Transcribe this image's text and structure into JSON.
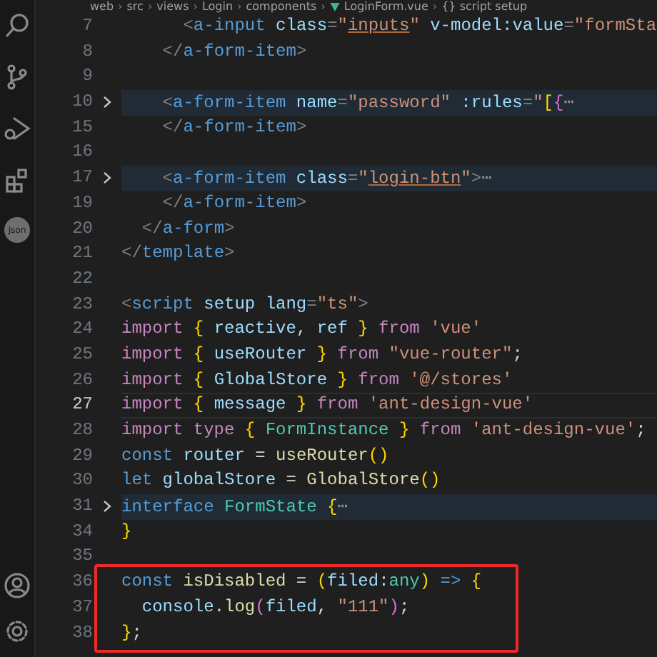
{
  "breadcrumb": [
    {
      "text": "web",
      "kind": "folder"
    },
    {
      "text": "›",
      "kind": "separator"
    },
    {
      "text": "src",
      "kind": "folder"
    },
    {
      "text": "›",
      "kind": "separator"
    },
    {
      "text": "views",
      "kind": "folder"
    },
    {
      "text": "›",
      "kind": "separator"
    },
    {
      "text": "Login",
      "kind": "folder"
    },
    {
      "text": "›",
      "kind": "separator"
    },
    {
      "text": "components",
      "kind": "folder"
    },
    {
      "text": "›",
      "kind": "separator"
    },
    {
      "text": "LoginForm.vue",
      "kind": "vue"
    },
    {
      "text": "›",
      "kind": "separator"
    },
    {
      "text": "{} script setup",
      "kind": "symbol"
    }
  ],
  "activity_bar": {
    "top": [
      {
        "kind": "search"
      },
      {
        "kind": "source"
      },
      {
        "kind": "debug"
      },
      {
        "kind": "extensions"
      },
      {
        "kind": "json",
        "label": "Json"
      }
    ],
    "bottom": [
      {
        "kind": "account"
      },
      {
        "kind": "gear"
      }
    ]
  },
  "lines": [
    {
      "number": "7",
      "fold": false,
      "highlighted": false,
      "current": false,
      "boxed": false,
      "tokens": [
        {
          "kind": "p",
          "text": "      <"
        },
        {
          "kind": "tag",
          "text": "a-input"
        },
        {
          "kind": "attr",
          "text": " class"
        },
        {
          "kind": "p",
          "text": "="
        },
        {
          "kind": "str",
          "text": "\""
        },
        {
          "kind": "ustr",
          "text": "inputs"
        },
        {
          "kind": "str",
          "text": "\""
        },
        {
          "kind": "attr",
          "text": " v-model:value"
        },
        {
          "kind": "p",
          "text": "="
        },
        {
          "kind": "str",
          "text": "\"formSta"
        }
      ]
    },
    {
      "number": "8",
      "fold": false,
      "highlighted": false,
      "current": false,
      "boxed": false,
      "tokens": [
        {
          "kind": "p",
          "text": "    </"
        },
        {
          "kind": "tag",
          "text": "a-form-item"
        },
        {
          "kind": "p",
          "text": ">"
        }
      ]
    },
    {
      "number": "9",
      "fold": false,
      "highlighted": false,
      "current": false,
      "boxed": false
    },
    {
      "number": "10",
      "fold": true,
      "highlighted": true,
      "current": false,
      "boxed": false,
      "tokens": [
        {
          "kind": "p",
          "text": "    <"
        },
        {
          "kind": "tag",
          "text": "a-form-item"
        },
        {
          "kind": "attr",
          "text": " name"
        },
        {
          "kind": "p",
          "text": "="
        },
        {
          "kind": "str",
          "text": "\"password\""
        },
        {
          "kind": "attr",
          "text": " :rules"
        },
        {
          "kind": "p",
          "text": "="
        },
        {
          "kind": "str",
          "text": "\""
        },
        {
          "kind": "b1",
          "text": "["
        },
        {
          "kind": "b2",
          "text": "{"
        },
        {
          "kind": "fold",
          "text": "⋯"
        }
      ]
    },
    {
      "number": "15",
      "fold": false,
      "highlighted": false,
      "current": false,
      "boxed": false,
      "tokens": [
        {
          "kind": "p",
          "text": "    </"
        },
        {
          "kind": "tag",
          "text": "a-form-item"
        },
        {
          "kind": "p",
          "text": ">"
        }
      ]
    },
    {
      "number": "16",
      "fold": false,
      "highlighted": false,
      "current": false,
      "boxed": false
    },
    {
      "number": "17",
      "fold": true,
      "highlighted": true,
      "current": false,
      "boxed": false,
      "tokens": [
        {
          "kind": "p",
          "text": "    <"
        },
        {
          "kind": "tag",
          "text": "a-form-item"
        },
        {
          "kind": "attr",
          "text": " class"
        },
        {
          "kind": "p",
          "text": "="
        },
        {
          "kind": "str",
          "text": "\""
        },
        {
          "kind": "ustr",
          "text": "login-btn"
        },
        {
          "kind": "str",
          "text": "\""
        },
        {
          "kind": "p",
          "text": ">"
        },
        {
          "kind": "fold",
          "text": "⋯"
        }
      ]
    },
    {
      "number": "19",
      "fold": false,
      "highlighted": false,
      "current": false,
      "boxed": false,
      "tokens": [
        {
          "kind": "p",
          "text": "    </"
        },
        {
          "kind": "tag",
          "text": "a-form-item"
        },
        {
          "kind": "p",
          "text": ">"
        }
      ]
    },
    {
      "number": "20",
      "fold": false,
      "highlighted": false,
      "current": false,
      "boxed": false,
      "tokens": [
        {
          "kind": "p",
          "text": "  </"
        },
        {
          "kind": "tag",
          "text": "a-form"
        },
        {
          "kind": "p",
          "text": ">"
        }
      ]
    },
    {
      "number": "21",
      "fold": false,
      "highlighted": false,
      "current": false,
      "boxed": false,
      "tokens": [
        {
          "kind": "p",
          "text": "</"
        },
        {
          "kind": "tag",
          "text": "template"
        },
        {
          "kind": "p",
          "text": ">"
        }
      ]
    },
    {
      "number": "22",
      "fold": false,
      "highlighted": false,
      "current": false,
      "boxed": false
    },
    {
      "number": "23",
      "fold": false,
      "highlighted": false,
      "current": false,
      "boxed": false,
      "tokens": [
        {
          "kind": "p",
          "text": "<"
        },
        {
          "kind": "tag",
          "text": "script"
        },
        {
          "kind": "attr",
          "text": " setup lang"
        },
        {
          "kind": "p",
          "text": "="
        },
        {
          "kind": "str",
          "text": "\"ts\""
        },
        {
          "kind": "p",
          "text": ">"
        }
      ]
    },
    {
      "number": "24",
      "fold": false,
      "highlighted": false,
      "current": false,
      "boxed": false,
      "tokens": [
        {
          "kind": "kw",
          "text": "import "
        },
        {
          "kind": "b1",
          "text": "{"
        },
        {
          "kind": "var",
          "text": " reactive"
        },
        {
          "kind": "text",
          "text": ", "
        },
        {
          "kind": "var",
          "text": "ref "
        },
        {
          "kind": "b1",
          "text": "}"
        },
        {
          "kind": "kw",
          "text": " from "
        },
        {
          "kind": "str",
          "text": "'vue'"
        }
      ]
    },
    {
      "number": "25",
      "fold": false,
      "highlighted": false,
      "current": false,
      "boxed": false,
      "tokens": [
        {
          "kind": "kw",
          "text": "import "
        },
        {
          "kind": "b1",
          "text": "{"
        },
        {
          "kind": "var",
          "text": " useRouter "
        },
        {
          "kind": "b1",
          "text": "}"
        },
        {
          "kind": "kw",
          "text": " from "
        },
        {
          "kind": "str",
          "text": "\"vue-router\""
        },
        {
          "kind": "text",
          "text": ";"
        }
      ]
    },
    {
      "number": "26",
      "fold": false,
      "highlighted": false,
      "current": false,
      "boxed": false,
      "tokens": [
        {
          "kind": "kw",
          "text": "import "
        },
        {
          "kind": "b1",
          "text": "{"
        },
        {
          "kind": "var",
          "text": " GlobalStore "
        },
        {
          "kind": "b1",
          "text": "}"
        },
        {
          "kind": "kw",
          "text": " from "
        },
        {
          "kind": "str",
          "text": "'@/stores'"
        }
      ]
    },
    {
      "number": "27",
      "fold": false,
      "highlighted": false,
      "current": true,
      "boxed": false,
      "tokens": [
        {
          "kind": "kw",
          "text": "import "
        },
        {
          "kind": "b1",
          "text": "{"
        },
        {
          "kind": "var",
          "text": " message "
        },
        {
          "kind": "b1",
          "text": "}"
        },
        {
          "kind": "kw",
          "text": " from "
        },
        {
          "kind": "str",
          "text": "'ant-design-vue'"
        }
      ]
    },
    {
      "number": "28",
      "fold": false,
      "highlighted": false,
      "current": false,
      "boxed": false,
      "tokens": [
        {
          "kind": "kw",
          "text": "import type "
        },
        {
          "kind": "b1",
          "text": "{"
        },
        {
          "kind": "type",
          "text": " FormInstance "
        },
        {
          "kind": "b1",
          "text": "}"
        },
        {
          "kind": "kw",
          "text": " from "
        },
        {
          "kind": "str",
          "text": "'ant-design-vue'"
        },
        {
          "kind": "text",
          "text": ";"
        }
      ]
    },
    {
      "number": "29",
      "fold": false,
      "highlighted": false,
      "current": false,
      "boxed": false,
      "tokens": [
        {
          "kind": "decl",
          "text": "const"
        },
        {
          "kind": "var",
          "text": " router"
        },
        {
          "kind": "text",
          "text": " = "
        },
        {
          "kind": "fn",
          "text": "useRouter"
        },
        {
          "kind": "b1",
          "text": "()"
        }
      ]
    },
    {
      "number": "30",
      "fold": false,
      "highlighted": false,
      "current": false,
      "boxed": false,
      "tokens": [
        {
          "kind": "decl",
          "text": "let"
        },
        {
          "kind": "var",
          "text": " globalStore"
        },
        {
          "kind": "text",
          "text": " = "
        },
        {
          "kind": "fn",
          "text": "GlobalStore"
        },
        {
          "kind": "b1",
          "text": "()"
        }
      ]
    },
    {
      "number": "31",
      "fold": true,
      "highlighted": true,
      "current": false,
      "boxed": false,
      "tokens": [
        {
          "kind": "decl",
          "text": "interface"
        },
        {
          "kind": "type",
          "text": " FormState "
        },
        {
          "kind": "b1",
          "text": "{"
        },
        {
          "kind": "fold",
          "text": "⋯"
        }
      ]
    },
    {
      "number": "34",
      "fold": false,
      "highlighted": false,
      "current": false,
      "boxed": false,
      "tokens": [
        {
          "kind": "b1",
          "text": "}"
        }
      ]
    },
    {
      "number": "35",
      "fold": false,
      "highlighted": false,
      "current": false,
      "boxed": false
    },
    {
      "number": "36",
      "fold": false,
      "highlighted": false,
      "current": false,
      "boxed": true,
      "tokens": [
        {
          "kind": "decl",
          "text": "const"
        },
        {
          "kind": "fn",
          "text": " isDisabled"
        },
        {
          "kind": "text",
          "text": " = "
        },
        {
          "kind": "b1",
          "text": "("
        },
        {
          "kind": "var",
          "text": "filed"
        },
        {
          "kind": "text",
          "text": ":"
        },
        {
          "kind": "type",
          "text": "any"
        },
        {
          "kind": "b1",
          "text": ")"
        },
        {
          "kind": "decl",
          "text": " => "
        },
        {
          "kind": "b1",
          "text": "{"
        }
      ]
    },
    {
      "number": "37",
      "fold": false,
      "highlighted": false,
      "current": false,
      "boxed": true,
      "tokens": [
        {
          "kind": "var",
          "text": "  console"
        },
        {
          "kind": "text",
          "text": "."
        },
        {
          "kind": "fn",
          "text": "log"
        },
        {
          "kind": "b2",
          "text": "("
        },
        {
          "kind": "var",
          "text": "filed"
        },
        {
          "kind": "text",
          "text": ", "
        },
        {
          "kind": "str",
          "text": "\"111\""
        },
        {
          "kind": "b2",
          "text": ")"
        },
        {
          "kind": "text",
          "text": ";"
        }
      ]
    },
    {
      "number": "38",
      "fold": false,
      "highlighted": false,
      "current": false,
      "boxed": true,
      "tokens": [
        {
          "kind": "b1",
          "text": "}"
        },
        {
          "kind": "text",
          "text": ";"
        }
      ]
    }
  ]
}
